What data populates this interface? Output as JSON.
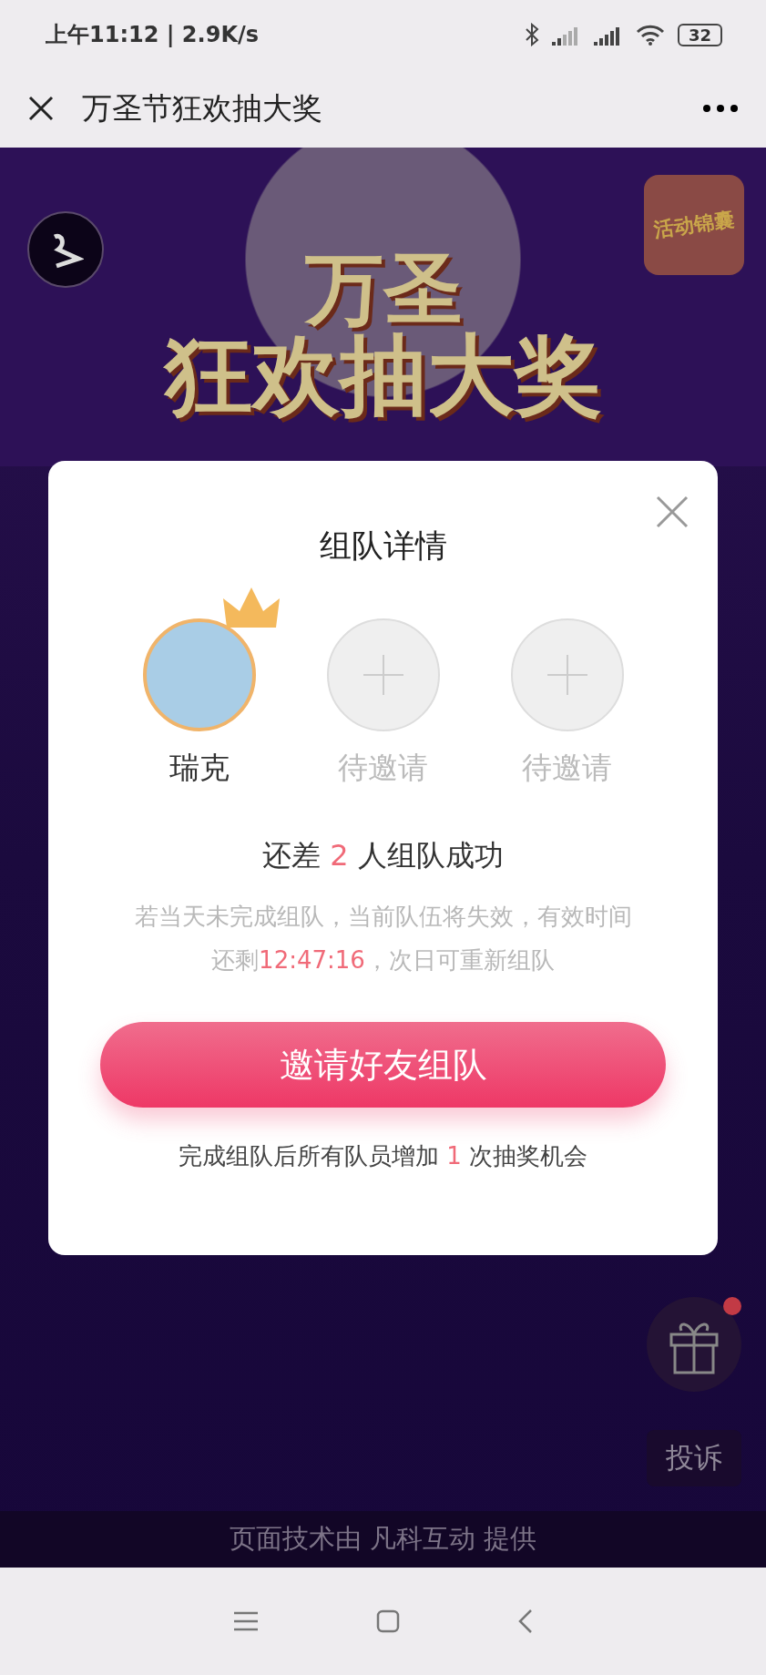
{
  "status_bar": {
    "time": "上午11:12 | 2.9K/s",
    "battery": "32"
  },
  "nav": {
    "title": "万圣节狂欢抽大奖"
  },
  "banner": {
    "title_lines": [
      "万圣",
      "狂欢抽大奖"
    ],
    "badge": "活动锦囊"
  },
  "modal": {
    "title": "组队详情",
    "members": [
      {
        "name": "瑞克",
        "kind": "leader"
      },
      {
        "name": "待邀请",
        "kind": "empty"
      },
      {
        "name": "待邀请",
        "kind": "empty"
      }
    ],
    "status": {
      "before": "还差",
      "count": "2",
      "after": "人组队成功"
    },
    "notice": {
      "before": "若当天未完成组队，当前队伍将失效，有效时间还剩",
      "time": "12:47:16",
      "after": "，次日可重新组队"
    },
    "button": "邀请好友组队",
    "note": {
      "before": "完成组队后所有队员增加",
      "count": "1",
      "after": "次抽奖机会"
    }
  },
  "side": {
    "gift_notification": true,
    "complaint": "投诉"
  },
  "footer": "页面技术由 凡科互动 提供"
}
